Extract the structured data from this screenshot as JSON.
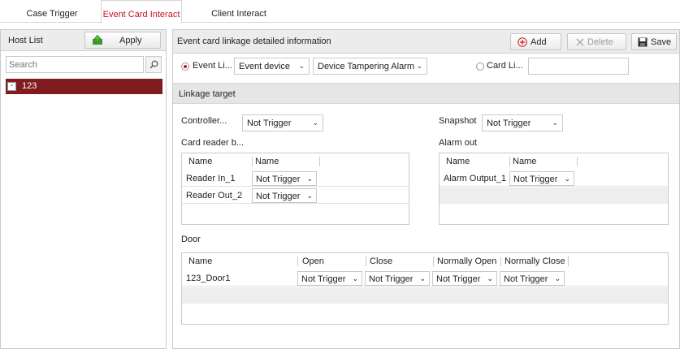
{
  "tabs": [
    {
      "label": "Case Trigger",
      "active": false
    },
    {
      "label": "Event Card Interact",
      "active": true
    },
    {
      "label": "Client Interact",
      "active": false
    }
  ],
  "colors": {
    "accent": "#c8141e",
    "selected_row": "#7f1c1f"
  },
  "host_list": {
    "title": "Host List",
    "apply_label": "Apply",
    "search_placeholder": "Search",
    "tree": [
      {
        "label": "123",
        "toggle": "-",
        "selected": true
      }
    ]
  },
  "panel": {
    "title": "Event card linkage detailed information",
    "add_label": "Add",
    "delete_label": "Delete",
    "save_label": "Save"
  },
  "options": {
    "event_linkage_label": "Event Li...",
    "event_source": "Event device",
    "event_type": "Device Tampering Alarm",
    "card_linkage_label": "Card Li...",
    "card_value": ""
  },
  "linkage_target": {
    "title": "Linkage target",
    "controller_label": "Controller...",
    "controller_value": "Not Trigger",
    "snapshot_label": "Snapshot",
    "snapshot_value": "Not Trigger",
    "card_reader_label": "Card reader b...",
    "card_reader_headers": [
      "Name",
      "Name"
    ],
    "card_readers": [
      {
        "name": "Reader In_1",
        "value": "Not Trigger"
      },
      {
        "name": "Reader Out_2",
        "value": "Not Trigger"
      }
    ],
    "alarm_out_label": "Alarm out",
    "alarm_out_headers": [
      "Name",
      "Name"
    ],
    "alarm_outputs": [
      {
        "name": "Alarm Output_1",
        "value": "Not Trigger"
      }
    ],
    "door_label": "Door",
    "door_headers": [
      "Name",
      "Open",
      "Close",
      "Normally Open",
      "Normally Close"
    ],
    "doors": [
      {
        "name": "123_Door1",
        "open": "Not Trigger",
        "close": "Not Trigger",
        "normally_open": "Not Trigger",
        "normally_close": "Not Trigger"
      }
    ]
  }
}
